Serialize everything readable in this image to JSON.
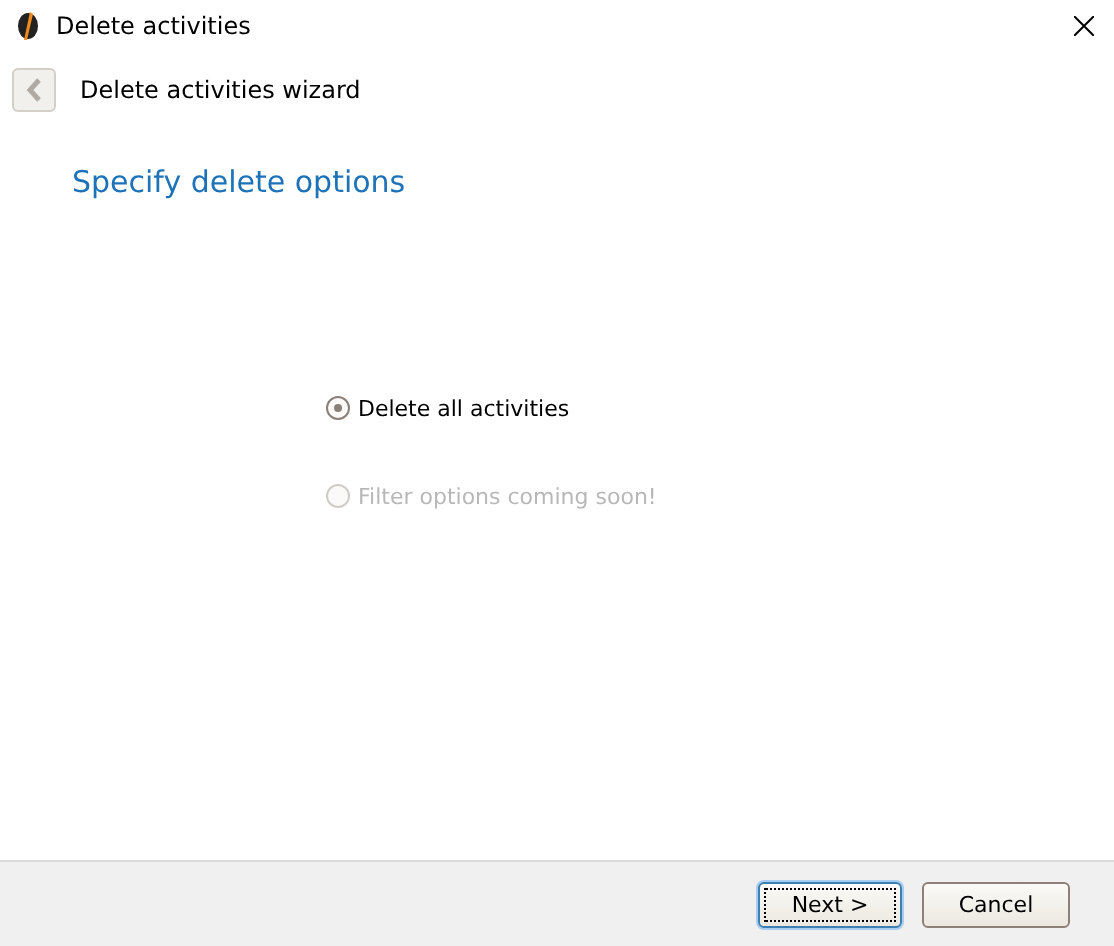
{
  "window": {
    "title": "Delete activities"
  },
  "wizard": {
    "title": "Delete activities wizard",
    "back_disabled": true
  },
  "heading": "Specify delete options",
  "options": [
    {
      "label": "Delete all activities",
      "selected": true,
      "disabled": false
    },
    {
      "label": "Filter options coming soon!",
      "selected": false,
      "disabled": true
    }
  ],
  "buttons": [
    {
      "label": "Next >",
      "default": true
    },
    {
      "label": "Cancel",
      "default": false
    }
  ]
}
